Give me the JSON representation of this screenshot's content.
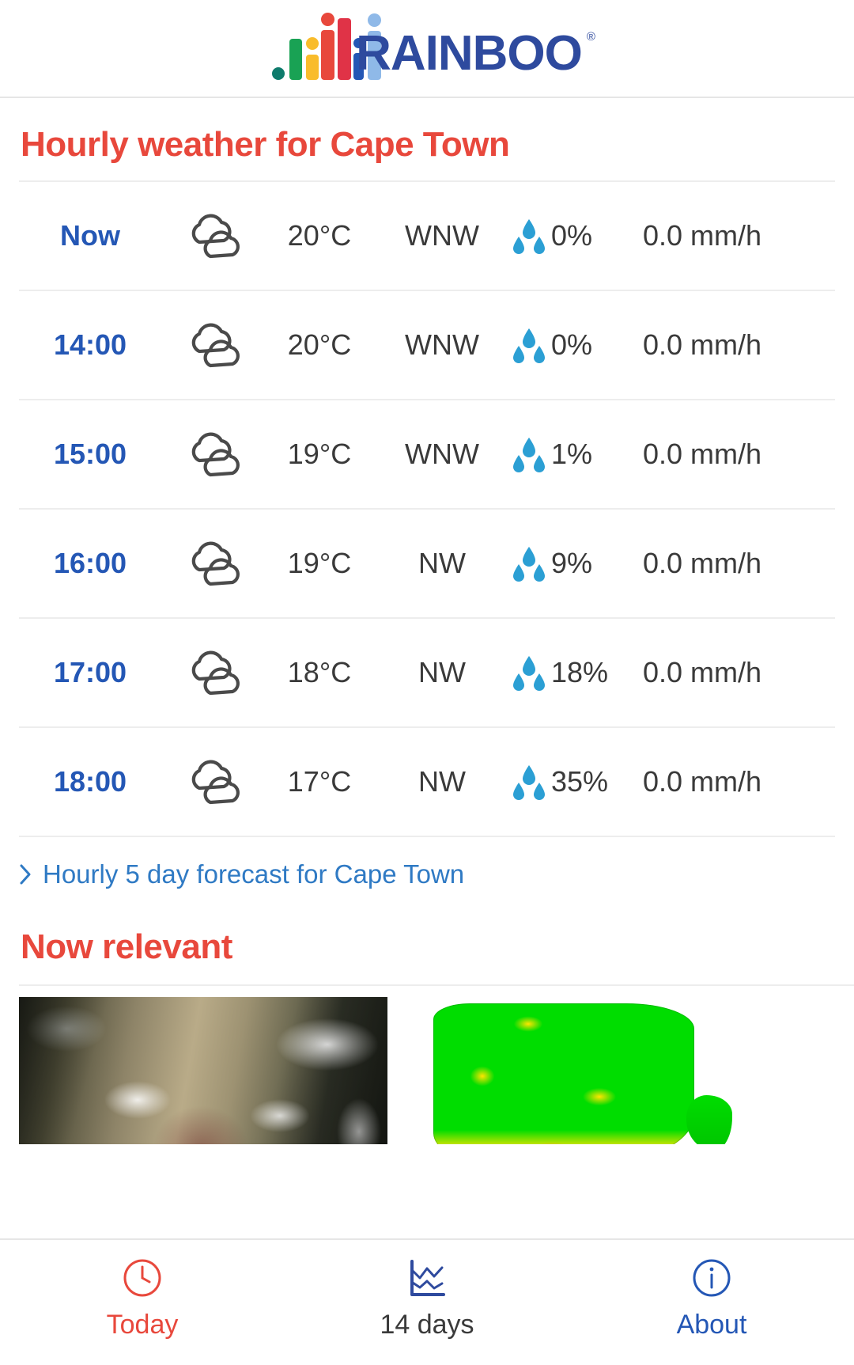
{
  "brand": {
    "name": "RAINBOO",
    "registered_mark": "®",
    "logo_icon": "bar-chart-logo-icon",
    "word_color": "#2e4a9e",
    "bars": [
      {
        "color": "#0e7b6c",
        "type": "dot"
      },
      {
        "color": "#19a254",
        "type": "bar"
      },
      {
        "color": "#f9bc2b",
        "type": "bar-with-dot"
      },
      {
        "color": "#e8483c",
        "type": "bar-with-dot"
      },
      {
        "color": "#e03347",
        "type": "bar"
      },
      {
        "color": "#2457b5",
        "type": "bar-with-dot-navy"
      },
      {
        "color": "#8fb9e8",
        "type": "bar-with-dot-light"
      }
    ]
  },
  "hourly": {
    "title": "Hourly weather for Cape Town",
    "title_color": "#e8483c",
    "columns": [
      "time",
      "condition",
      "temperature",
      "wind_direction",
      "precip_probability",
      "precip_rate"
    ],
    "rows": [
      {
        "time": "Now",
        "icon": "cloudy-icon",
        "temperature": "20°C",
        "wind": "WNW",
        "drops_icon": "raindrops-icon",
        "pop": "0%",
        "rain": "0.0 mm/h"
      },
      {
        "time": "14:00",
        "icon": "cloudy-icon",
        "temperature": "20°C",
        "wind": "WNW",
        "drops_icon": "raindrops-icon",
        "pop": "0%",
        "rain": "0.0 mm/h"
      },
      {
        "time": "15:00",
        "icon": "cloudy-icon",
        "temperature": "19°C",
        "wind": "WNW",
        "drops_icon": "raindrops-icon",
        "pop": "1%",
        "rain": "0.0 mm/h"
      },
      {
        "time": "16:00",
        "icon": "cloudy-icon",
        "temperature": "19°C",
        "wind": "NW",
        "drops_icon": "raindrops-icon",
        "pop": "9%",
        "rain": "0.0 mm/h"
      },
      {
        "time": "17:00",
        "icon": "cloudy-icon",
        "temperature": "18°C",
        "wind": "NW",
        "drops_icon": "raindrops-icon",
        "pop": "18%",
        "rain": "0.0 mm/h"
      },
      {
        "time": "18:00",
        "icon": "cloudy-icon",
        "temperature": "17°C",
        "wind": "NW",
        "drops_icon": "raindrops-icon",
        "pop": "35%",
        "rain": "0.0 mm/h"
      }
    ]
  },
  "forecast_link": {
    "icon": "chevron-right-icon",
    "label": "Hourly 5 day forecast for Cape Town",
    "color": "#2f7ac4"
  },
  "relevant": {
    "title": "Now relevant",
    "title_color": "#e8483c",
    "cards": [
      {
        "name": "satellite-image-card",
        "alt": "satellite image"
      },
      {
        "name": "precipitation-map-card",
        "alt": "precipitation map"
      }
    ]
  },
  "bottom_nav": {
    "items": [
      {
        "id": "today",
        "icon": "clock-icon",
        "label": "Today",
        "color": "#e8483c",
        "active": true
      },
      {
        "id": "days14",
        "icon": "line-chart-icon",
        "label": "14 days",
        "color": "#3a3a3a",
        "active": false
      },
      {
        "id": "about",
        "icon": "info-icon",
        "label": "About",
        "color": "#2457b5",
        "active": false
      }
    ]
  }
}
